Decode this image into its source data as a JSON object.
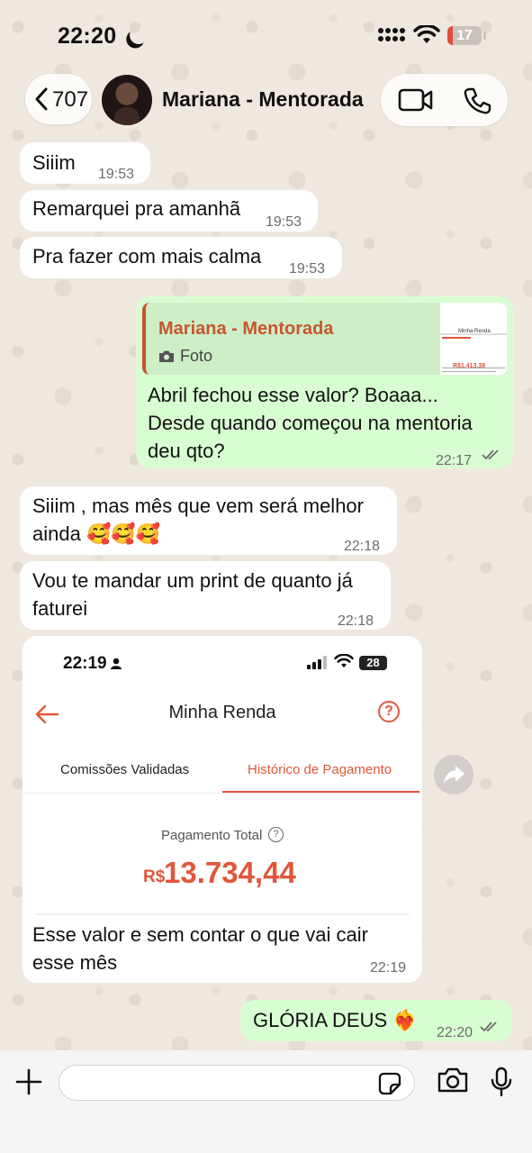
{
  "status_bar": {
    "time": "22:20",
    "battery": "17",
    "battery_level": 0.17
  },
  "header": {
    "back_count": "707",
    "contact_name": "Mariana - Mentorada"
  },
  "messages": [
    {
      "dir": "in",
      "text": "Siiim",
      "time": "19:53"
    },
    {
      "dir": "in",
      "text": "Remarquei pra amanhã",
      "time": "19:53"
    },
    {
      "dir": "in",
      "text": "Pra fazer com mais calma",
      "time": "19:53"
    },
    {
      "dir": "out",
      "reply_name": "Mariana - Mentorada",
      "reply_type": "Foto",
      "lines": [
        "Abril fechou esse valor? Boaaa...",
        "Desde quando começou na mentoria",
        "deu qto?"
      ],
      "time": "22:17"
    },
    {
      "dir": "in",
      "lines": [
        "Siiim , mas mês que vem será melhor",
        "ainda 🥰🥰🥰"
      ],
      "time": "22:18"
    },
    {
      "dir": "in",
      "lines": [
        "Vou te mandar um print de quanto já",
        "faturei"
      ],
      "time": "22:18"
    },
    {
      "dir": "in",
      "type": "image",
      "caption": [
        "Esse valor e sem contar o que vai cair",
        "esse mês"
      ],
      "time": "22:19"
    },
    {
      "dir": "out",
      "text": "GLÓRIA DEUS ❤️‍🔥",
      "time": "22:20"
    }
  ],
  "screenshot": {
    "time": "22:19",
    "battery": "28",
    "title": "Minha Renda",
    "tab_left": "Comissões Validadas",
    "tab_right": "Histórico de Pagamento",
    "total_label": "Pagamento Total",
    "currency": "R$",
    "amount": "13.734,44",
    "accent": "#e0573a"
  },
  "reply_thumb": {
    "title": "Minha Renda",
    "amount": "R$1.413,38"
  },
  "icons": [
    "back-chevron-icon",
    "video-call-icon",
    "phone-icon",
    "plus-icon",
    "sticker-icon",
    "camera-icon",
    "microphone-icon",
    "forward-icon",
    "double-check-icon"
  ],
  "colors": {
    "incoming": "#ffffff",
    "outgoing": "#d9fdd3",
    "reply_accent": "#c5562e"
  }
}
